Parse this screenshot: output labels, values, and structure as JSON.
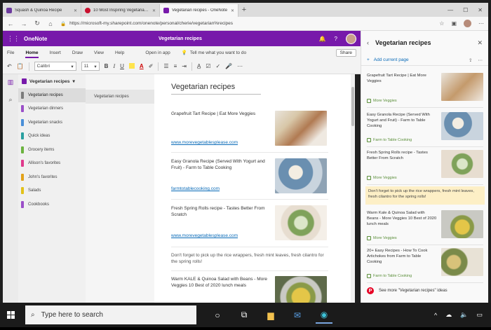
{
  "browser": {
    "tabs": [
      {
        "title": "Squash & Quinoa Recipe",
        "icon_color": "#6c3a9e"
      },
      {
        "title": "10 Most Inspiring Vegetarian Recipes",
        "icon_color": "#c8102e"
      },
      {
        "title": "Vegetarian recipes - OneNote",
        "icon_color": "#7719aa"
      }
    ],
    "new_tab": "+",
    "url": "https://microsoft-my.sharepoint.com/onenote/personal/cherie/vegetarian%recipes"
  },
  "app": {
    "name": "OneNote",
    "notebook_title": "Vegetarian recipes",
    "brand_color": "#7719aa"
  },
  "ribbon": {
    "tabs": [
      "File",
      "Home",
      "Insert",
      "Draw",
      "View",
      "Help"
    ],
    "active_tab": "Home",
    "open_in_app": "Open in app",
    "tell_me": "Tell me what you want to do",
    "share": "Share"
  },
  "toolbar": {
    "font_name": "Calibri",
    "font_size": "11",
    "bold": "B",
    "italic": "I",
    "underline": "U"
  },
  "notebook": {
    "name": "Vegetarian recipes",
    "sections": [
      {
        "label": "Vegetarian recipes",
        "color": "#7b7b7b"
      },
      {
        "label": "Vegetarian dinners",
        "color": "#9b4fc8"
      },
      {
        "label": "Vegetarian snacks",
        "color": "#4a8fd8"
      },
      {
        "label": "Quick ideas",
        "color": "#2aa0a0"
      },
      {
        "label": "Grocery items",
        "color": "#6cb33f"
      },
      {
        "label": "Allison's favorites",
        "color": "#e03a8c"
      },
      {
        "label": "John's favorites",
        "color": "#e2a21a"
      },
      {
        "label": "Salads",
        "color": "#e2c21a"
      },
      {
        "label": "Cookbooks",
        "color": "#9b4fc8"
      }
    ],
    "active_section": "Vegetarian recipes",
    "pages": [
      "Vegetarian recipes"
    ]
  },
  "canvas": {
    "page_title": "Vegetarian recipes",
    "recipes": [
      {
        "title": "Grapefruit Tart Recipe | Eat More Veggies",
        "link": "www.morevegetablesplease.com"
      },
      {
        "title": "Easy Granola Recipe (Served With Yogurt and Fruit) - Farm to Table Cooking",
        "link": "farmtotablecooking.com"
      },
      {
        "title": "Fresh Spring Rolls recipe - Tastes Better From Scratch",
        "link": "www.morevegetablesplease.com"
      },
      {
        "title": "Warm KALE & Quinoa Salad with Beans - More Veggies 10 Best of 2020 lunch meals",
        "link": ""
      }
    ],
    "note": "Don't forget to pick up the rice wrappers, fresh mint leaves, fresh cilantro for the spring rolls!"
  },
  "side_panel": {
    "title": "Vegetarian recipes",
    "add_current_page": "Add current page",
    "cards": [
      {
        "title": "Grapefruit Tart Recipe | Eat More Veggies",
        "source": "More Veggies"
      },
      {
        "title": "Easy Granola Recipe (Served With Yogurt and Fruit) - Farm to Table Cooking",
        "source": "Farm to Table Cooking"
      },
      {
        "title": "Fresh Spring Rolls recipe - Tastes Better From Scratch",
        "source": "More Veggies"
      },
      {
        "title": "Warm Kale & Quinoa Salad with Beans - More Veggies 10 Best of 2020 lunch meals",
        "source": "More Veggies"
      },
      {
        "title": "20+ Easy Recipes - How To Cook Artichokes from Farm to Table Cooking",
        "source": "Farm to Table Cooking"
      }
    ],
    "note": "Don't forget to pick up the rice wrappers, fresh mint leaves, fresh cilantro for the spring rolls!",
    "footer": "See more \"Vegetarian recipes\" ideas"
  },
  "taskbar": {
    "search_placeholder": "Type here to search"
  }
}
